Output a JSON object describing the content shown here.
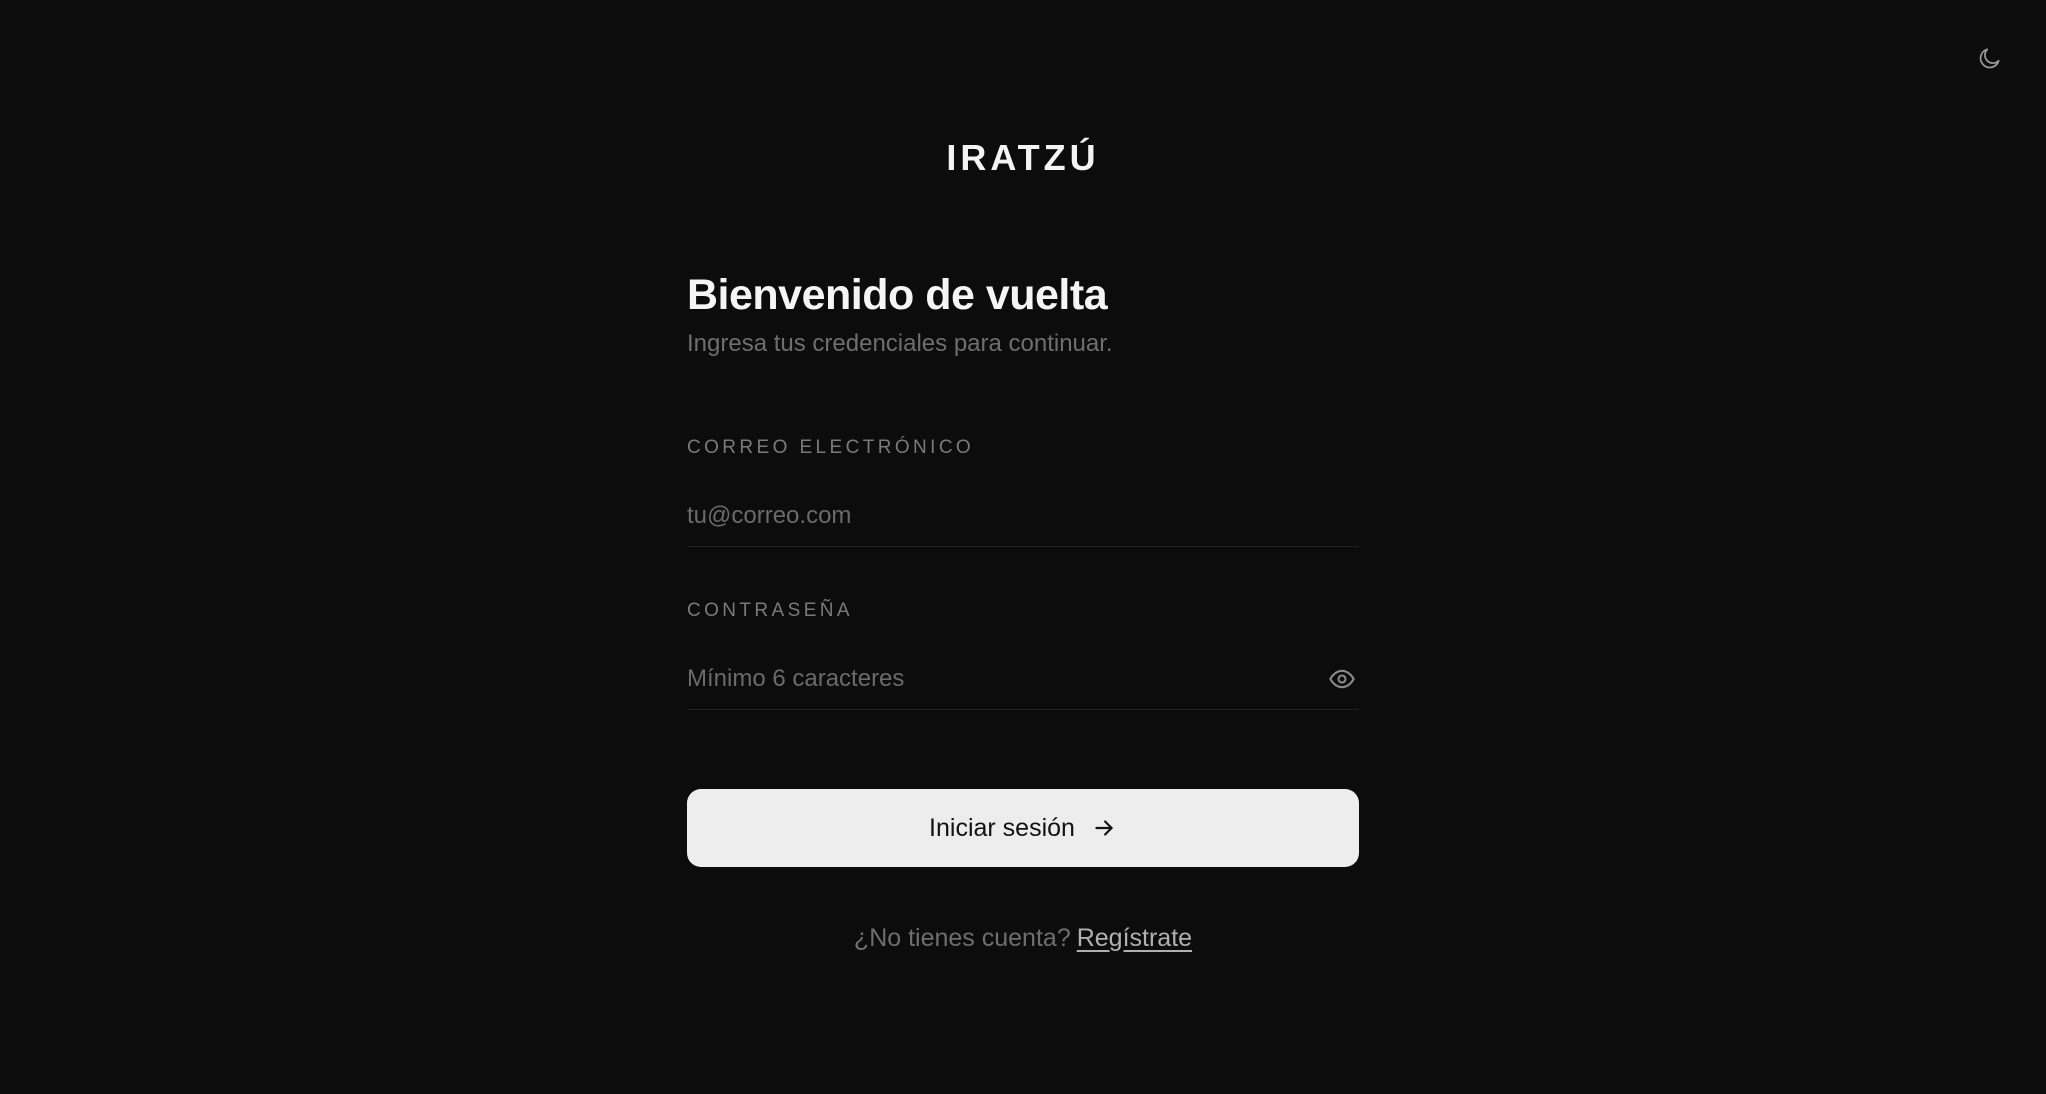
{
  "header": {
    "brand": "IRATZÚ",
    "theme_toggle_icon": "moon-icon"
  },
  "login": {
    "title": "Bienvenido de vuelta",
    "subtitle": "Ingresa tus credenciales para continuar.",
    "email": {
      "label": "CORREO ELECTRÓNICO",
      "placeholder": "tu@correo.com",
      "value": ""
    },
    "password": {
      "label": "CONTRASEÑA",
      "placeholder": "Mínimo 6 caracteres",
      "value": "",
      "toggle_icon": "eye-icon"
    },
    "submit": {
      "label": "Iniciar sesión",
      "icon": "arrow-right-icon"
    },
    "signup": {
      "prompt": "¿No tienes cuenta?",
      "link_label": "Regístrate"
    }
  },
  "colors": {
    "background": "#0c0c0c",
    "primary_text": "#f5f5f5",
    "muted_text": "#6e6e6e",
    "button_background": "#ededed",
    "button_text": "#121212"
  }
}
